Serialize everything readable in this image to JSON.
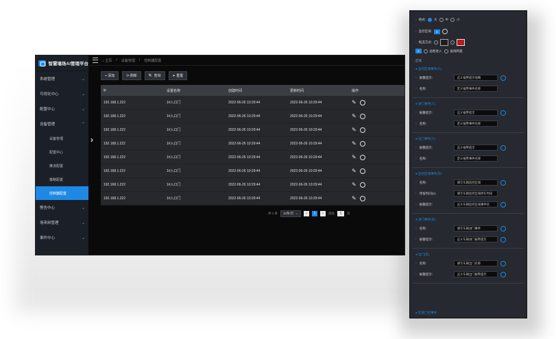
{
  "app": {
    "title": "智慧墙场AI管理平台"
  },
  "sidebar": {
    "items": [
      {
        "label": "系统管理",
        "chevron": "⌄"
      },
      {
        "label": "可视化中心",
        "chevron": "⌄"
      },
      {
        "label": "配置中心",
        "chevron": "⌄"
      },
      {
        "label": "设备管理",
        "chevron": "⌃"
      }
    ],
    "subitems": [
      {
        "label": "设备管理"
      },
      {
        "label": "配置中心"
      },
      {
        "label": "推流配置"
      },
      {
        "label": "策略配置"
      },
      {
        "label": "控制器配置"
      }
    ],
    "items_after": [
      {
        "label": "警告中心",
        "chevron": "⌄"
      },
      {
        "label": "场来树管理",
        "chevron": "⌄"
      },
      {
        "label": "事件中心",
        "chevron": "⌄"
      }
    ]
  },
  "breadcrumb": {
    "home": "⌂ 主页",
    "sep": "/",
    "b1": "设备管理",
    "b2": "控制器配置"
  },
  "toolbar": {
    "add": "+ 添加",
    "refresh": "⟳ 刷新",
    "query": "🔍 查询",
    "reset": "➤ 重置"
  },
  "table": {
    "headers": [
      "ip",
      "设置名称",
      "创建时间",
      "更新时间",
      "操作"
    ],
    "rows": [
      [
        "192.168.1.222",
        "1#入口门",
        "2022-06-26 10:29:44",
        "2022-06-26 10:29:44"
      ],
      [
        "192.168.1.222",
        "1#入口门",
        "2022-06-26 10:29:44",
        "2022-06-26 10:29:44"
      ],
      [
        "192.168.1.222",
        "1#入口门",
        "2022-06-26 10:29:44",
        "2022-06-26 10:29:44"
      ],
      [
        "192.168.1.222",
        "1#入口门",
        "2022-06-26 10:29:44",
        "2022-06-26 10:29:44"
      ],
      [
        "192.168.1.222",
        "1#入口门",
        "2022-06-26 10:29:44",
        "2022-06-26 10:29:44"
      ],
      [
        "192.168.1.222",
        "1#入口门",
        "2022-06-26 10:29:44",
        "2022-06-26 10:29:44"
      ],
      [
        "192.168.1.222",
        "1#入口门",
        "2022-06-26 10:29:44",
        "2022-06-26 10:29:44"
      ],
      [
        "192.168.1.222",
        "1#入口门",
        "2022-06-26 10:29:44",
        "2022-06-26 10:29:44"
      ]
    ]
  },
  "pager": {
    "total": "共 1 条",
    "size": "10条/页",
    "prev": "‹",
    "page": "1",
    "next": "›",
    "goto": "前往",
    "goto_value": "1",
    "page_unit": "页"
  },
  "panel": {
    "r1_label": "格式:",
    "r1_opts": [
      "大",
      "中",
      "小"
    ],
    "r2_label": "监控区域:",
    "r2_val": "4",
    "r3_label": "框选方式:",
    "r4_btn": "1",
    "r4_opts": [
      "画框进入",
      "画线跨越"
    ],
    "s_top": "区域",
    "sections": [
      {
        "title": "● 监控区域事件(人)",
        "fields": [
          {
            "label": "报警提示:",
            "value": "这义报警提示语精"
          },
          {
            "label": "名称:",
            "value": "定义报警事件名称"
          }
        ]
      },
      {
        "title": "● 进门事件(人)",
        "fields": [
          {
            "label": "报警提示:",
            "value": "这义报警提示"
          },
          {
            "label": "名称:",
            "value": "定义报警事件名称"
          }
        ]
      },
      {
        "title": "● 出门事件(人)",
        "fields": [
          {
            "label": "报警提示:",
            "value": "这义报警提示"
          },
          {
            "label": "名称:",
            "value": "定义报警事件名称"
          }
        ]
      },
      {
        "title": "● 监控区域事件(车)",
        "fields": [
          {
            "label": "名称:",
            "value": "填写车辆监控区域"
          },
          {
            "label": "停留时间(s):",
            "value": "填写车辆监控区域停车时间"
          },
          {
            "label": "报警提示:",
            "value": "这义车辆监控区域事件名"
          }
        ]
      },
      {
        "title": "● 进门事件(车)",
        "fields": [
          {
            "label": "名称:",
            "value": "填写车辆进门事件"
          },
          {
            "label": "报警提示:",
            "value": "这义车辆进门报警提示"
          }
        ]
      },
      {
        "title": "● 出门(车)",
        "fields": [
          {
            "label": "名称:",
            "value": "填写车辆出门名称"
          },
          {
            "label": "报警提示:",
            "value": "这义车辆出门报警提示"
          }
        ]
      }
    ],
    "bottom": "● 区域门控事件"
  }
}
